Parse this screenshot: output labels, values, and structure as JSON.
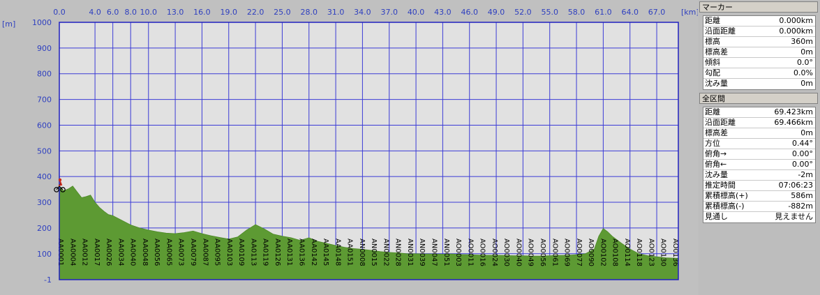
{
  "chart_data": {
    "type": "area",
    "xunit": "[km]",
    "yunit": "[m]",
    "xlim": [
      0.0,
      69.423
    ],
    "ylim": [
      -1,
      1000
    ],
    "x_ticks": [
      "0.0",
      "4.0",
      "6.0",
      "8.0",
      "10.0",
      "13.0",
      "16.0",
      "19.0",
      "22.0",
      "25.0",
      "28.0",
      "31.0",
      "34.0",
      "37.0",
      "40.0",
      "43.0",
      "46.0",
      "49.0",
      "52.0",
      "55.0",
      "58.0",
      "61.0",
      "64.0",
      "67.0"
    ],
    "y_ticks": [
      "1000",
      "900",
      "800",
      "700",
      "600",
      "500",
      "400",
      "300",
      "200",
      "100",
      "-1"
    ],
    "waypoints": [
      "AA0001",
      "AA0004",
      "AA0012",
      "AA0017",
      "AA0026",
      "AA0034",
      "AA0040",
      "AA0048",
      "AA0056",
      "AA0065",
      "AA0073",
      "AA0079",
      "AA0087",
      "AA0095",
      "AA0103",
      "AA0109",
      "AA0113",
      "AA0119",
      "AA0126",
      "AA0131",
      "AA0136",
      "AA0142",
      "AA0145",
      "AA0148",
      "AA0151",
      "AN0008",
      "AN0015",
      "AN0022",
      "AN0028",
      "AN0031",
      "AN0039",
      "AN0047",
      "AN0051",
      "AO0003",
      "AO0011",
      "AO0016",
      "AO0024",
      "AO0030",
      "AO0040",
      "AO0049",
      "AO0056",
      "AO0061",
      "AO0069",
      "AO0077",
      "AO0090",
      "AO0102",
      "AO0108",
      "AO0114",
      "AO0118",
      "AO0123",
      "AO0130",
      "AO0136"
    ],
    "profile": {
      "x": [
        0.0,
        0.5,
        1.0,
        1.5,
        2.0,
        2.5,
        3.0,
        3.5,
        4.0,
        4.5,
        5.0,
        5.5,
        6.0,
        7.0,
        8.0,
        9.0,
        10.0,
        11.0,
        12.0,
        13.0,
        14.0,
        15.0,
        16.0,
        17.0,
        18.0,
        19.0,
        20.0,
        21.0,
        22.0,
        23.0,
        24.0,
        25.0,
        26.0,
        27.0,
        28.0,
        29.0,
        30.0,
        31.0,
        32.0,
        33.0,
        34.0,
        35.0,
        36.0,
        37.0,
        38.0,
        39.0,
        40.0,
        41.0,
        42.0,
        43.0,
        44.0,
        45.0,
        46.0,
        47.0,
        48.0,
        49.0,
        50.0,
        51.0,
        52.0,
        53.0,
        54.0,
        55.0,
        56.0,
        57.0,
        58.0,
        59.0,
        60.0,
        60.5,
        61.0,
        61.5,
        62.0,
        63.0,
        64.0,
        65.0,
        66.0,
        67.0,
        68.0,
        69.423
      ],
      "y": [
        360,
        345,
        352,
        363,
        340,
        318,
        322,
        328,
        300,
        280,
        265,
        252,
        248,
        230,
        212,
        200,
        192,
        185,
        180,
        178,
        182,
        188,
        178,
        170,
        163,
        157,
        165,
        192,
        213,
        196,
        176,
        168,
        162,
        152,
        162,
        148,
        140,
        132,
        125,
        120,
        117,
        113,
        108,
        105,
        103,
        100,
        100,
        99,
        99,
        98,
        99,
        97,
        96,
        95,
        94,
        94,
        93,
        92,
        92,
        91,
        91,
        92,
        93,
        94,
        96,
        100,
        118,
        168,
        198,
        185,
        168,
        142,
        118,
        100,
        92,
        88,
        84,
        82
      ]
    }
  },
  "panel": {
    "marker_header": "マーカー",
    "marker_rows": [
      {
        "label": "距離",
        "value": "0.000km"
      },
      {
        "label": "沿面距離",
        "value": "0.000km"
      },
      {
        "label": "標高",
        "value": "360m"
      },
      {
        "label": "標高差",
        "value": "0m"
      },
      {
        "label": "傾斜",
        "value": "0.0°"
      },
      {
        "label": "勾配",
        "value": "0.0%"
      },
      {
        "label": "沈み量",
        "value": "0m"
      }
    ],
    "section_header": "全区間",
    "section_rows": [
      {
        "label": "距離",
        "value": "69.423km"
      },
      {
        "label": "沿面距離",
        "value": "69.466km"
      },
      {
        "label": "標高差",
        "value": "0m"
      },
      {
        "label": "方位",
        "value": "0.44°"
      },
      {
        "label": "俯角→",
        "value": "0.00°"
      },
      {
        "label": "俯角←",
        "value": "0.00°"
      },
      {
        "label": "沈み量",
        "value": "-2m"
      },
      {
        "label": "推定時間",
        "value": "07:06:23"
      },
      {
        "label": "累積標高(+)",
        "value": "586m"
      },
      {
        "label": "累積標高(-)",
        "value": "-882m"
      },
      {
        "label": "見通し",
        "value": "見えません"
      }
    ]
  },
  "colors": {
    "plot_bg": "#e1e1e1",
    "grid": "#3b3bd6",
    "fill": "#5d9a33",
    "axis_text": "#2e3fbf",
    "marker": "#cc2a1a"
  },
  "icons": {
    "marker": "cyclist-icon"
  }
}
